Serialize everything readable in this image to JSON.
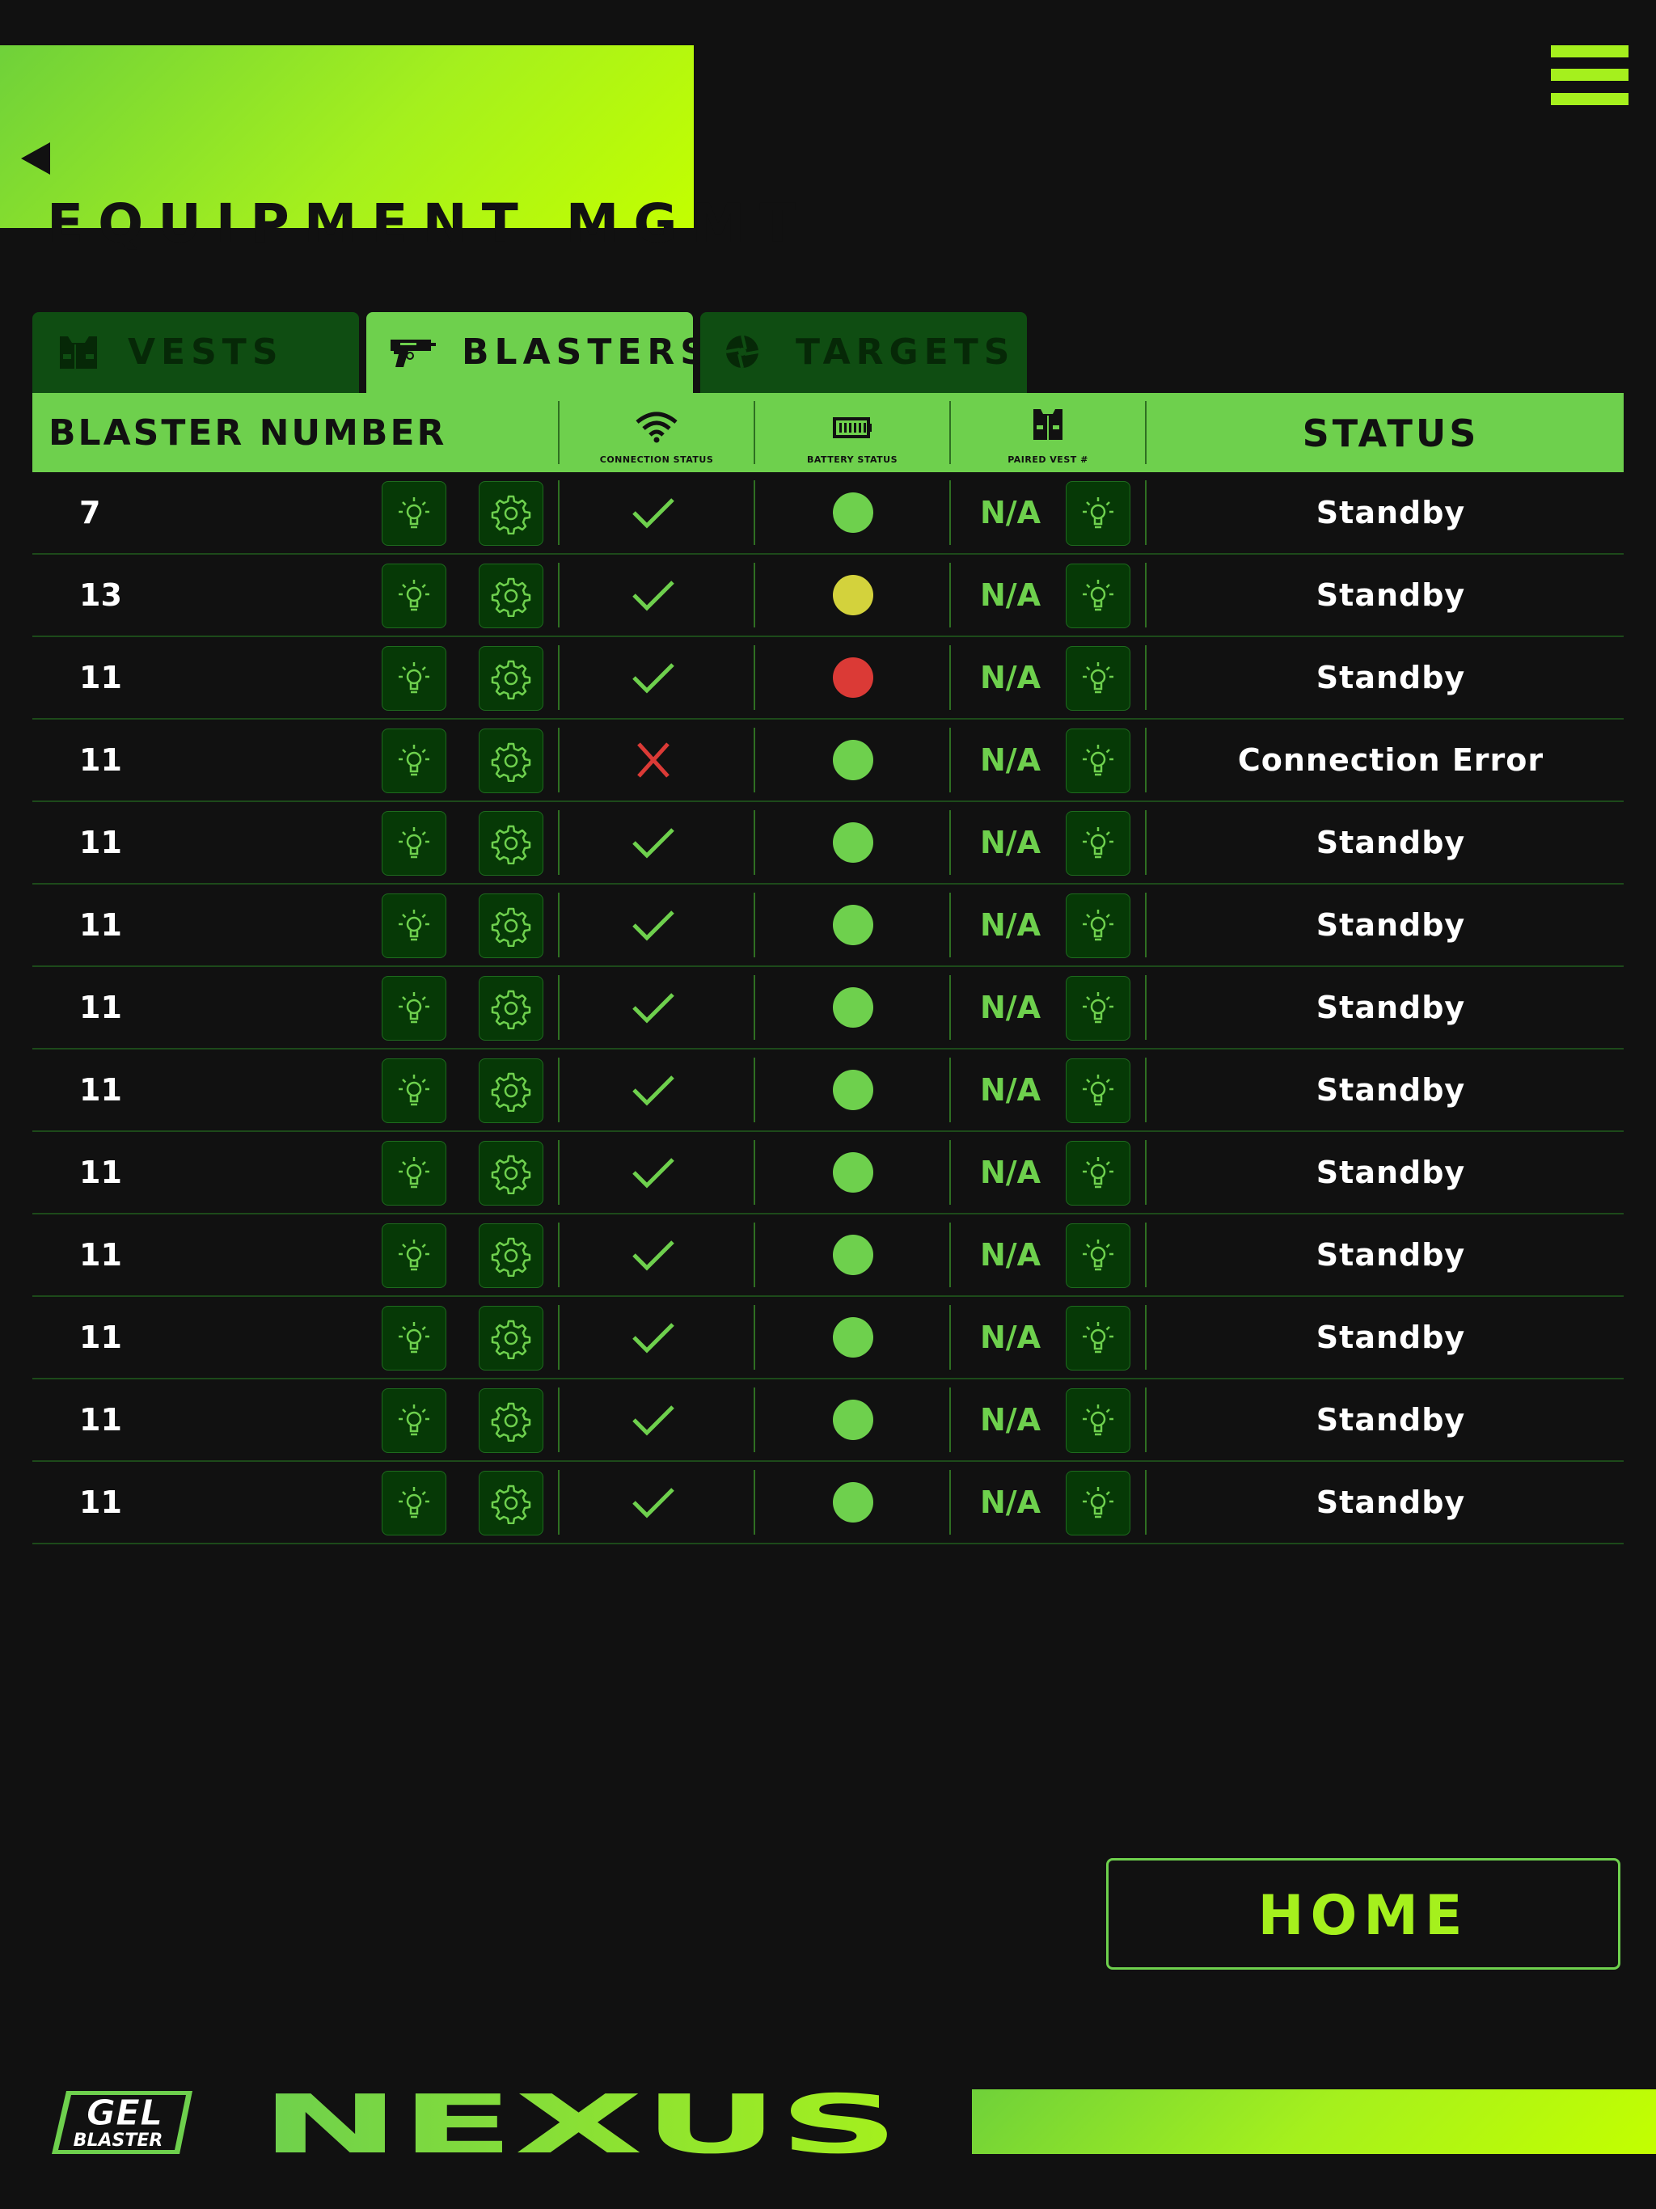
{
  "header": {
    "title": "EQUIPMENT MGMT"
  },
  "tabs": [
    {
      "label": "VESTS",
      "icon": "vest-icon",
      "active": false
    },
    {
      "label": "BLASTERS",
      "icon": "blaster-icon",
      "active": true
    },
    {
      "label": "TARGETS",
      "icon": "target-icon",
      "active": false
    }
  ],
  "table": {
    "headers": {
      "blaster_number": "BLASTER NUMBER",
      "connection_status": "CONNECTION STATUS",
      "battery_status": "BATTERY STATUS",
      "paired_vest": "PAIRED VEST #",
      "status": "STATUS"
    },
    "rows": [
      {
        "number": "7",
        "connected": true,
        "battery": "green",
        "vest": "N/A",
        "status": "Standby"
      },
      {
        "number": "13",
        "connected": true,
        "battery": "yellow",
        "vest": "N/A",
        "status": "Standby"
      },
      {
        "number": "11",
        "connected": true,
        "battery": "red",
        "vest": "N/A",
        "status": "Standby"
      },
      {
        "number": "11",
        "connected": false,
        "battery": "green",
        "vest": "N/A",
        "status": "Connection Error"
      },
      {
        "number": "11",
        "connected": true,
        "battery": "green",
        "vest": "N/A",
        "status": "Standby"
      },
      {
        "number": "11",
        "connected": true,
        "battery": "green",
        "vest": "N/A",
        "status": "Standby"
      },
      {
        "number": "11",
        "connected": true,
        "battery": "green",
        "vest": "N/A",
        "status": "Standby"
      },
      {
        "number": "11",
        "connected": true,
        "battery": "green",
        "vest": "N/A",
        "status": "Standby"
      },
      {
        "number": "11",
        "connected": true,
        "battery": "green",
        "vest": "N/A",
        "status": "Standby"
      },
      {
        "number": "11",
        "connected": true,
        "battery": "green",
        "vest": "N/A",
        "status": "Standby"
      },
      {
        "number": "11",
        "connected": true,
        "battery": "green",
        "vest": "N/A",
        "status": "Standby"
      },
      {
        "number": "11",
        "connected": true,
        "battery": "green",
        "vest": "N/A",
        "status": "Standby"
      },
      {
        "number": "11",
        "connected": true,
        "battery": "green",
        "vest": "N/A",
        "status": "Standby"
      }
    ]
  },
  "home_button": {
    "label": "HOME"
  },
  "footer": {
    "logo_gel": {
      "line1": "GEL",
      "line2": "BLASTER"
    },
    "logo_nexus": "NEXUS"
  },
  "colors": {
    "accent_lime": "#a5f01d",
    "accent_green": "#6ed04d",
    "tab_inactive": "#0f4d12",
    "background": "#111111",
    "battery_green": "#6ed04d",
    "battery_yellow": "#d3d23c",
    "battery_red": "#db3a36",
    "error_red": "#db3a36"
  }
}
